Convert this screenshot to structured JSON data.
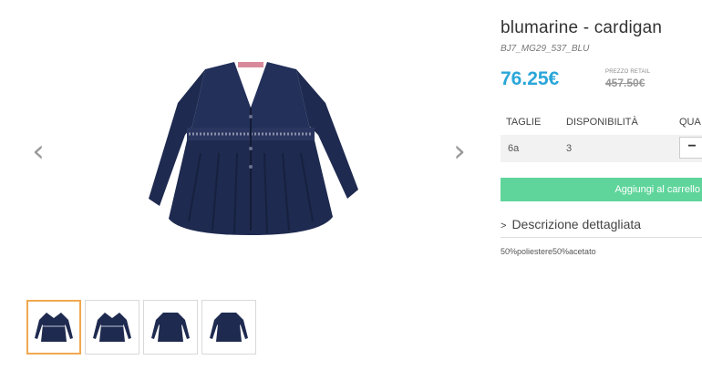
{
  "product": {
    "title": "blumarine - cardigan",
    "sku": "BJ7_MG29_537_BLU",
    "price": "76.25€",
    "retail_label": "PREZZO RETAIL",
    "retail_price": "457.50€",
    "garment_color": "#1e2a4f"
  },
  "gallery": {
    "prev_icon": "‹",
    "next_icon": "›",
    "thumbnail_count": 4,
    "active_thumbnail": 1
  },
  "sizes_table": {
    "headers": [
      "TAGLIE",
      "DISPONIBILITÀ",
      "QUA"
    ],
    "rows": [
      {
        "size": "6a",
        "availability": "3",
        "qty_button": "−"
      }
    ]
  },
  "cart_button": {
    "label": "Aggiungi al carrello",
    "color": "#5fd59b"
  },
  "description": {
    "toggle_label": "Descrizione dettagliata",
    "toggle_icon": ">",
    "text": "50%poliestere50%acetato"
  },
  "colors": {
    "accent": "#2aa6d9",
    "active_thumb_border": "#f0a850"
  }
}
